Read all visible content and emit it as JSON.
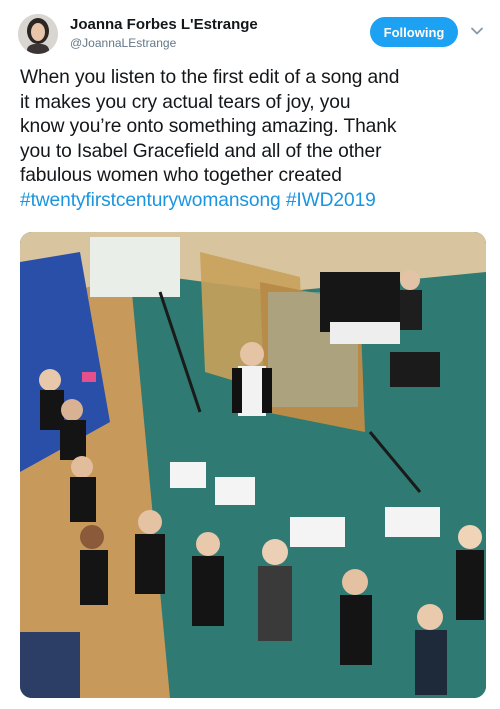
{
  "author": {
    "name": "Joanna Forbes L'Estrange",
    "handle": "@JoannaLEstrange",
    "avatar_icon": "profile-photo"
  },
  "follow_button": {
    "label": "Following",
    "color": "#1da1f2"
  },
  "menu_icon": "chevron-down-icon",
  "tweet": {
    "lines": [
      "When you listen to the first edit of a song and",
      "it makes you cry actual tears of joy, you",
      "know you’re onto something amazing. Thank",
      "you to Isabel Gracefield and all of the other",
      "fabulous women who together created"
    ],
    "hashtags": [
      "#twentyfirstcenturywomansong",
      "#IWD2019"
    ],
    "hashtag_color": "#1b95e0"
  },
  "media": {
    "type": "photo",
    "subject": "group-of-women-in-recording-studio"
  }
}
